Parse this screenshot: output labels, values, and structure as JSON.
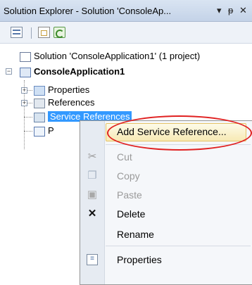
{
  "window": {
    "title": "Solution Explorer - Solution 'ConsoleAp...",
    "dropdown_glyph": "▾",
    "pin_glyph": "ᵽ",
    "close_glyph": "✕"
  },
  "toolbar": {
    "icons": [
      "properties-icon",
      "show-all-files-icon",
      "refresh-icon"
    ]
  },
  "tree": {
    "solution_label": "Solution 'ConsoleApplication1' (1 project)",
    "project_label": "ConsoleApplication1",
    "items": [
      {
        "label": "Properties",
        "icon": "properties-folder-icon"
      },
      {
        "label": "References",
        "icon": "references-folder-icon"
      },
      {
        "label": "Service References",
        "icon": "service-references-folder-icon",
        "selected": true
      },
      {
        "label": "P",
        "icon": "csharp-file-icon"
      }
    ]
  },
  "context_menu": {
    "items": [
      {
        "label": "Add Service Reference...",
        "icon": "",
        "highlighted": true
      },
      {
        "label": "Cut",
        "icon": "cut-icon",
        "enabled": false
      },
      {
        "label": "Copy",
        "icon": "copy-icon",
        "enabled": false
      },
      {
        "label": "Paste",
        "icon": "paste-icon",
        "enabled": false
      },
      {
        "label": "Delete",
        "icon": "delete-icon",
        "enabled": true
      },
      {
        "label": "Rename",
        "icon": "",
        "enabled": true
      },
      {
        "label": "Properties",
        "icon": "properties-icon",
        "enabled": true
      }
    ]
  },
  "colors": {
    "selection": "#3399ff",
    "annotation": "#e02020",
    "hover_fill": "#f7e9b4"
  }
}
